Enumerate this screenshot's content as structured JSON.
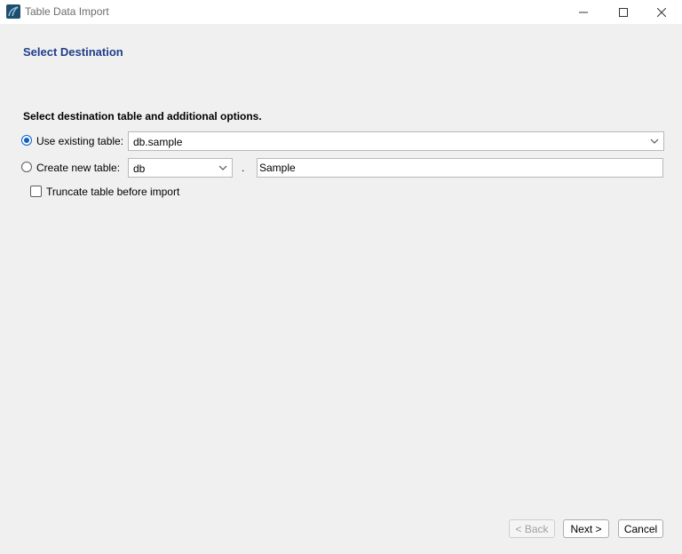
{
  "window": {
    "title": "Table Data Import",
    "controls": [
      "minimize-icon",
      "maximize-icon",
      "close-icon"
    ]
  },
  "page": {
    "title": "Select Destination",
    "instruction": "Select destination table and additional options."
  },
  "options": {
    "use_existing": {
      "label": "Use existing table:",
      "selected": true,
      "value": "db.sample"
    },
    "create_new": {
      "label": "Create new table:",
      "selected": false,
      "schema_value": "db",
      "separator": ".",
      "table_name": "Sample"
    },
    "truncate": {
      "label": "Truncate table before import",
      "checked": false
    }
  },
  "buttons": {
    "back": "< Back",
    "next": "Next >",
    "cancel": "Cancel"
  },
  "colors": {
    "accent": "#0a5fc4",
    "title_blue": "#1f3d8a",
    "background": "#f0f0f0"
  }
}
